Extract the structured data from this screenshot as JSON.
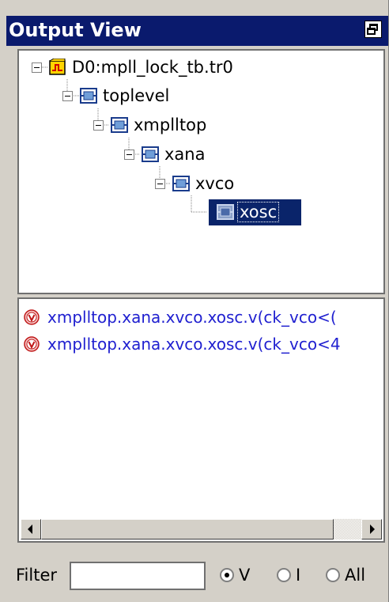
{
  "window": {
    "title": "Output View",
    "restore_icon": "restore-window-icon"
  },
  "tree": {
    "nodes": [
      {
        "label": "D0:mpll_lock_tb.tr0",
        "icon": "transient-file-icon",
        "expanded": true,
        "selected": false
      },
      {
        "label": "toplevel",
        "icon": "module-block-icon",
        "expanded": true,
        "selected": false
      },
      {
        "label": "xmplltop",
        "icon": "module-block-icon",
        "expanded": true,
        "selected": false
      },
      {
        "label": "xana",
        "icon": "module-block-icon",
        "expanded": true,
        "selected": false
      },
      {
        "label": "xvco",
        "icon": "module-block-icon",
        "expanded": true,
        "selected": false
      },
      {
        "label": "xosc",
        "icon": "module-block-icon",
        "expanded": false,
        "selected": true
      }
    ]
  },
  "outputs": {
    "items": [
      {
        "text": "xmplltop.xana.xvco.xosc.v(ck_vco<(",
        "icon": "voltage-signal-icon"
      },
      {
        "text": "xmplltop.xana.xvco.xosc.v(ck_vco<4",
        "icon": "voltage-signal-icon"
      }
    ],
    "text_color": "#2020d0"
  },
  "filter": {
    "label": "Filter",
    "value": "",
    "options": [
      {
        "label": "V",
        "checked": true
      },
      {
        "label": "I",
        "checked": false
      },
      {
        "label": "All",
        "checked": false
      }
    ]
  },
  "colors": {
    "title_bg": "#0a1a6d",
    "selection_bg": "#0a246a",
    "panel_bg": "#d4d0c8"
  }
}
